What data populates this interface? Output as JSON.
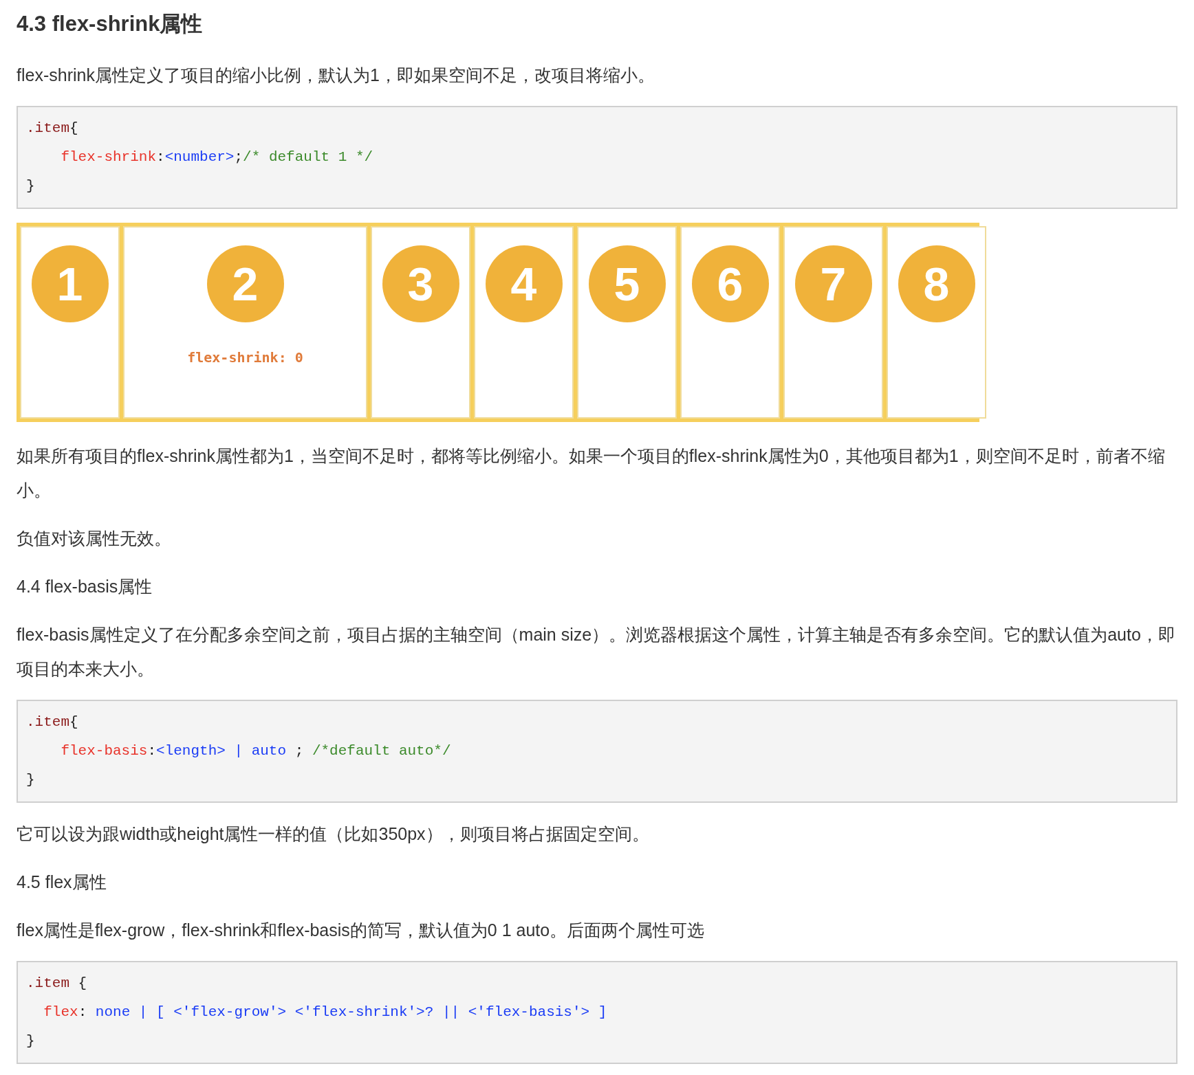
{
  "blocks": [
    {
      "kind": "heading",
      "text": "4.3 flex-shrink属性"
    },
    {
      "kind": "paragraph",
      "text": "flex-shrink属性定义了项目的缩小比例，默认为1，即如果空间不足，改项目将缩小。"
    },
    {
      "kind": "code",
      "lines": [
        [
          {
            "kind": "selector",
            "text": ".item"
          },
          {
            "kind": "punct",
            "text": "{"
          }
        ],
        [
          {
            "kind": "property",
            "text": "    flex-shrink"
          },
          {
            "kind": "punct",
            "text": ":"
          },
          {
            "kind": "value",
            "text": "<number>"
          },
          {
            "kind": "punct",
            "text": ";"
          },
          {
            "kind": "comment",
            "text": "/* default 1 */"
          }
        ],
        [
          {
            "kind": "punct",
            "text": "}"
          }
        ]
      ]
    },
    {
      "kind": "figure",
      "items": [
        {
          "label": "1"
        },
        {
          "label": "2",
          "note": "flex-shrink: 0"
        },
        {
          "label": "3"
        },
        {
          "label": "4"
        },
        {
          "label": "5"
        },
        {
          "label": "6"
        },
        {
          "label": "7"
        },
        {
          "label": "8"
        }
      ]
    },
    {
      "kind": "paragraph",
      "text": "如果所有项目的flex-shrink属性都为1，当空间不足时，都将等比例缩小。如果一个项目的flex-shrink属性为0，其他项目都为1，则空间不足时，前者不缩小。"
    },
    {
      "kind": "paragraph",
      "text": "负值对该属性无效。"
    },
    {
      "kind": "subheading",
      "text": "4.4 flex-basis属性"
    },
    {
      "kind": "paragraph",
      "text": "flex-basis属性定义了在分配多余空间之前，项目占据的主轴空间（main size）。浏览器根据这个属性，计算主轴是否有多余空间。它的默认值为auto，即项目的本来大小。"
    },
    {
      "kind": "code",
      "lines": [
        [
          {
            "kind": "selector",
            "text": ".item"
          },
          {
            "kind": "punct",
            "text": "{"
          }
        ],
        [
          {
            "kind": "property",
            "text": "    flex-basis"
          },
          {
            "kind": "punct",
            "text": ":"
          },
          {
            "kind": "value",
            "text": "<length> | auto"
          },
          {
            "kind": "punct",
            "text": " ; "
          },
          {
            "kind": "comment",
            "text": "/*default auto*/"
          }
        ],
        [
          {
            "kind": "punct",
            "text": "}"
          }
        ]
      ]
    },
    {
      "kind": "paragraph",
      "text": "它可以设为跟width或height属性一样的值（比如350px），则项目将占据固定空间。"
    },
    {
      "kind": "subheading",
      "text": "4.5 flex属性"
    },
    {
      "kind": "paragraph",
      "text": "flex属性是flex-grow，flex-shrink和flex-basis的简写，默认值为0 1 auto。后面两个属性可选"
    },
    {
      "kind": "code",
      "lines": [
        [
          {
            "kind": "selector",
            "text": ".item"
          },
          {
            "kind": "punct",
            "text": " {"
          }
        ],
        [
          {
            "kind": "property",
            "text": "  flex"
          },
          {
            "kind": "punct",
            "text": ": "
          },
          {
            "kind": "value",
            "text": "none | [ <'flex-grow'> <'flex-shrink'>? || <'flex-basis'> ]"
          }
        ],
        [
          {
            "kind": "punct",
            "text": "}"
          }
        ]
      ]
    }
  ]
}
